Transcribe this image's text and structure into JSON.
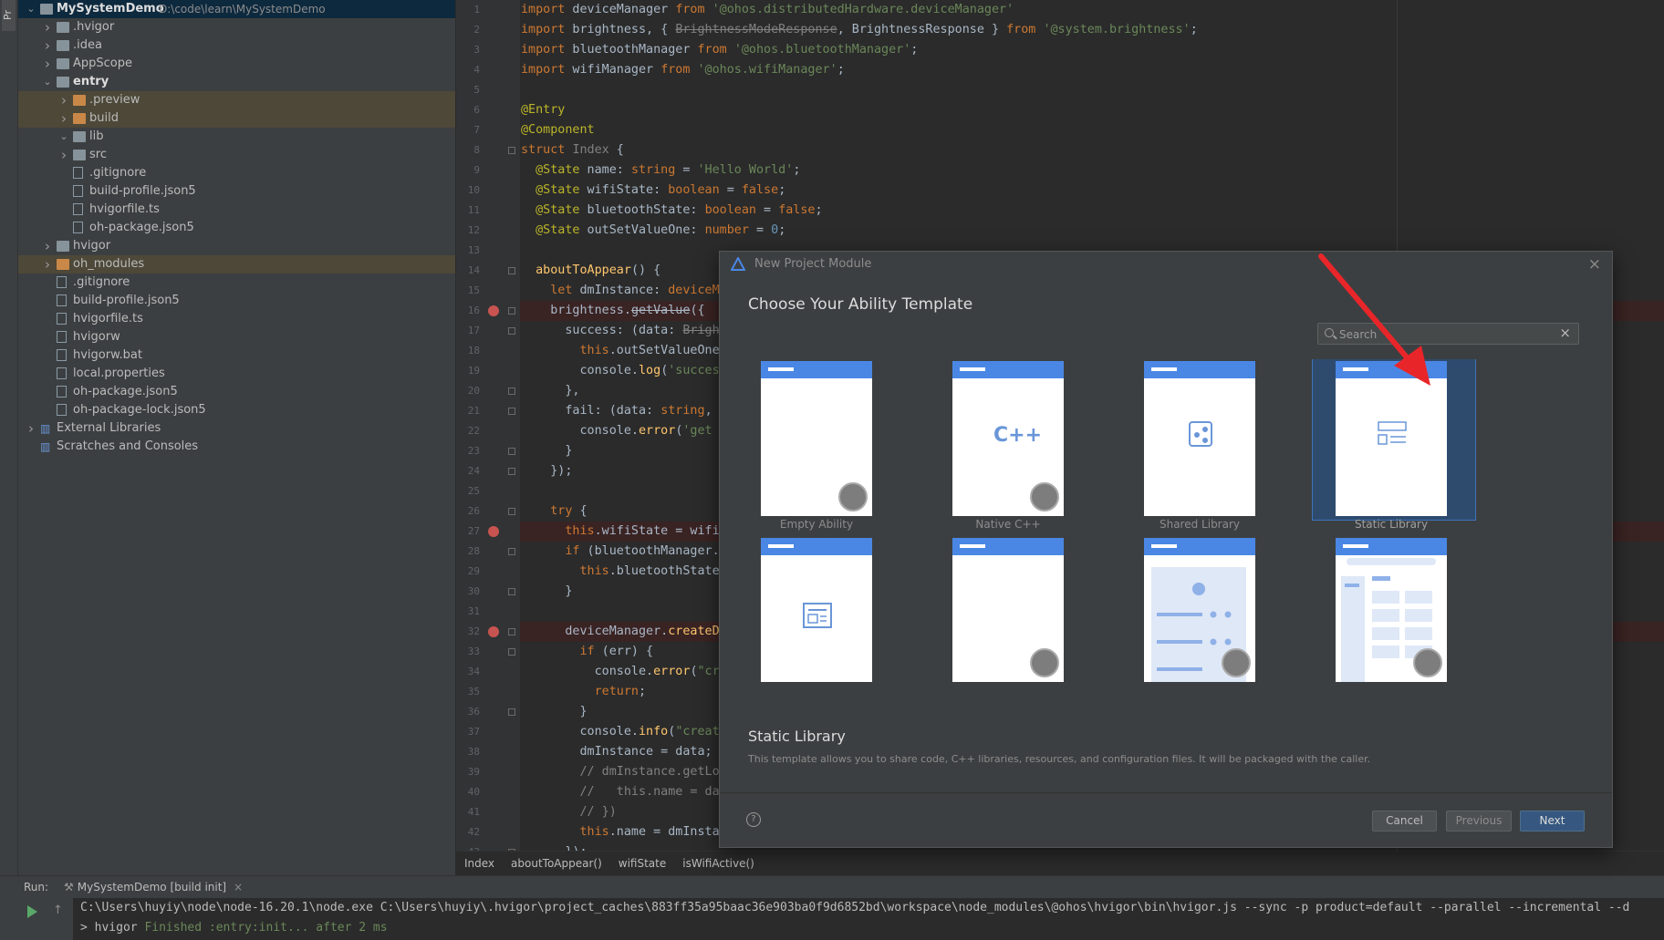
{
  "left_strip": {
    "label": "Pr"
  },
  "project_tree": [
    {
      "depth": 0,
      "chev": "v",
      "icon": "folder",
      "label": "MySystemDemo",
      "path": "D:\\code\\learn\\MySystemDemo",
      "state": "selected",
      "bold": true
    },
    {
      "depth": 1,
      "chev": ">",
      "icon": "folder",
      "label": ".hvigor"
    },
    {
      "depth": 1,
      "chev": ">",
      "icon": "folder",
      "label": ".idea"
    },
    {
      "depth": 1,
      "chev": ">",
      "icon": "folder",
      "label": "AppScope"
    },
    {
      "depth": 1,
      "chev": "v",
      "icon": "folder",
      "label": "entry",
      "bold": true
    },
    {
      "depth": 2,
      "chev": ">",
      "icon": "folder-orange",
      "label": ".preview",
      "state": "highlight"
    },
    {
      "depth": 2,
      "chev": ">",
      "icon": "folder-orange",
      "label": "build",
      "state": "highlight"
    },
    {
      "depth": 2,
      "chev": "v",
      "icon": "folder",
      "label": "lib"
    },
    {
      "depth": 2,
      "chev": ">",
      "icon": "folder",
      "label": "src"
    },
    {
      "depth": 2,
      "chev": "",
      "icon": "file",
      "label": ".gitignore"
    },
    {
      "depth": 2,
      "chev": "",
      "icon": "file",
      "label": "build-profile.json5"
    },
    {
      "depth": 2,
      "chev": "",
      "icon": "file",
      "label": "hvigorfile.ts"
    },
    {
      "depth": 2,
      "chev": "",
      "icon": "file",
      "label": "oh-package.json5"
    },
    {
      "depth": 1,
      "chev": ">",
      "icon": "folder",
      "label": "hvigor"
    },
    {
      "depth": 1,
      "chev": ">",
      "icon": "folder-orange",
      "label": "oh_modules",
      "state": "highlight"
    },
    {
      "depth": 1,
      "chev": "",
      "icon": "file",
      "label": ".gitignore"
    },
    {
      "depth": 1,
      "chev": "",
      "icon": "file",
      "label": "build-profile.json5"
    },
    {
      "depth": 1,
      "chev": "",
      "icon": "file",
      "label": "hvigorfile.ts"
    },
    {
      "depth": 1,
      "chev": "",
      "icon": "file",
      "label": "hvigorw"
    },
    {
      "depth": 1,
      "chev": "",
      "icon": "file",
      "label": "hvigorw.bat"
    },
    {
      "depth": 1,
      "chev": "",
      "icon": "file",
      "label": "local.properties"
    },
    {
      "depth": 1,
      "chev": "",
      "icon": "file",
      "label": "oh-package.json5"
    },
    {
      "depth": 1,
      "chev": "",
      "icon": "file",
      "label": "oh-package-lock.json5"
    },
    {
      "depth": 0,
      "chev": ">",
      "icon": "lib",
      "label": "External Libraries"
    },
    {
      "depth": 0,
      "chev": "",
      "icon": "lib",
      "label": "Scratches and Consoles"
    }
  ],
  "editor": {
    "lines": [
      {
        "n": "1",
        "html": "<span class=\"kw\">import</span> deviceManager <span class=\"kw\">from</span> <span class=\"str\">'@ohos.distributedHardware.deviceManager'</span>"
      },
      {
        "n": "2",
        "html": "<span class=\"kw\">import</span> brightness, { <s class=\"cmt\">BrightnessModeResponse</s>, BrightnessResponse } <span class=\"kw\">from</span> <span class=\"str\">'@system.brightness'</span>;"
      },
      {
        "n": "3",
        "html": "<span class=\"kw\">import</span> bluetoothManager <span class=\"kw\">from</span> <span class=\"str\">'@ohos.bluetoothManager'</span>;"
      },
      {
        "n": "4",
        "html": "<span class=\"kw\">import</span> wifiManager <span class=\"kw\">from</span> <span class=\"str\">'@ohos.wifiManager'</span>;"
      },
      {
        "n": "5",
        "html": ""
      },
      {
        "n": "6",
        "html": "<span class=\"anno\">@Entry</span>"
      },
      {
        "n": "7",
        "html": "<span class=\"anno\">@Component</span>"
      },
      {
        "n": "8",
        "html": "<span class=\"kw\">struct</span> <span class=\"cmt\">Index</span> {"
      },
      {
        "n": "9",
        "html": "  <span class=\"anno\">@State</span> name: <span class=\"kw\">string</span> = <span class=\"str\">'Hello World'</span>;"
      },
      {
        "n": "10",
        "html": "  <span class=\"anno\">@State</span> wifiState: <span class=\"kw\">boolean</span> = <span class=\"kw\">false</span>;"
      },
      {
        "n": "11",
        "html": "  <span class=\"anno\">@State</span> bluetoothState: <span class=\"kw\">boolean</span> = <span class=\"kw\">false</span>;"
      },
      {
        "n": "12",
        "html": "  <span class=\"anno\">@State</span> outSetValueOne: <span class=\"kw\">number</span> = <span class=\"num\">0</span>;"
      },
      {
        "n": "13",
        "html": ""
      },
      {
        "n": "14",
        "html": "  <span class=\"fn\">aboutToAppear</span>() {"
      },
      {
        "n": "15",
        "html": "    <span class=\"kw\">let</span> dmInstance: <span class=\"kw\">deviceM</span>"
      },
      {
        "n": "16",
        "html": "    brightness.<s>getValue</s>({",
        "bp": true
      },
      {
        "n": "17",
        "html": "      success: (data: <s class=\"cmt\">Brigh</s>"
      },
      {
        "n": "18",
        "html": "        <span class=\"kw\">this</span>.outSetValueOne"
      },
      {
        "n": "19",
        "html": "        console.<span class=\"fn\">log</span>(<span class=\"str\">'succes</span>"
      },
      {
        "n": "20",
        "html": "      },"
      },
      {
        "n": "21",
        "html": "      fail: (data: <span class=\"kw\">string</span>,"
      },
      {
        "n": "22",
        "html": "        console.<span class=\"fn\">error</span>(<span class=\"str\">'get</span>"
      },
      {
        "n": "23",
        "html": "      }"
      },
      {
        "n": "24",
        "html": "    });"
      },
      {
        "n": "25",
        "html": ""
      },
      {
        "n": "26",
        "html": "    <span class=\"kw\">try</span> {"
      },
      {
        "n": "27",
        "html": "      <span class=\"kw\">this</span>.wifiState = wifi",
        "bp": true
      },
      {
        "n": "28",
        "html": "      <span class=\"kw\">if</span> (bluetoothManager."
      },
      {
        "n": "29",
        "html": "        <span class=\"kw\">this</span>.bluetoothState"
      },
      {
        "n": "30",
        "html": "      }"
      },
      {
        "n": "31",
        "html": ""
      },
      {
        "n": "32",
        "html": "      deviceManager.<span class=\"fn\">createD</span>",
        "bp": true
      },
      {
        "n": "33",
        "html": "        <span class=\"kw\">if</span> (err) {"
      },
      {
        "n": "34",
        "html": "          console.<span class=\"fn\">error</span>(<span class=\"str\">\"cr</span>"
      },
      {
        "n": "35",
        "html": "          <span class=\"kw\">return</span>;"
      },
      {
        "n": "36",
        "html": "        }"
      },
      {
        "n": "37",
        "html": "        console.<span class=\"fn\">info</span>(<span class=\"str\">\"creat</span>"
      },
      {
        "n": "38",
        "html": "        dmInstance = data;"
      },
      {
        "n": "39",
        "html": "        <span class=\"cmt\">// dmInstance.getLo</span>"
      },
      {
        "n": "40",
        "html": "        <span class=\"cmt\">//   this.name = da</span>"
      },
      {
        "n": "41",
        "html": "        <span class=\"cmt\">// })</span>"
      },
      {
        "n": "42",
        "html": "        <span class=\"kw\">this</span>.name = dmInsta"
      },
      {
        "n": "43",
        "html": "      });"
      }
    ]
  },
  "breadcrumb": [
    "Index",
    "aboutToAppear()",
    "wifiState",
    "isWifiActive()"
  ],
  "run_panel": {
    "label": "Run:",
    "tab": "MySystemDemo [build init]",
    "tab_close": "×",
    "output_line1": "C:\\Users\\huyiy\\node\\node-16.20.1\\node.exe C:\\Users\\huyiy\\.hvigor\\project_caches\\883ff35a95baac36e903ba0f9d6852bd\\workspace\\node_modules\\@ohos\\hvigor\\bin\\hvigor.js --sync -p product=default --parallel --incremental --d",
    "output_line2_prefix": "> hvigor ",
    "output_line2_status": "Finished :entry:init... after 2 ms"
  },
  "modal": {
    "title": "New Project Module",
    "close": "×",
    "heading": "Choose Your Ability Template",
    "search_placeholder": "Search",
    "search_clear": "×",
    "templates": [
      {
        "name": "Empty Ability",
        "icon": "empty-ability-icon",
        "badge": true,
        "selected": false
      },
      {
        "name": "Native C++",
        "icon": "cpp-icon",
        "badge": true,
        "selected": false
      },
      {
        "name": "Shared Library",
        "icon": "shared-library-icon",
        "badge": false,
        "selected": false
      },
      {
        "name": "Static Library",
        "icon": "static-library-icon",
        "badge": false,
        "selected": true
      },
      {
        "name": "",
        "icon": "list-layout-icon",
        "badge": false,
        "selected": false
      },
      {
        "name": "",
        "icon": "profile-layout-icon",
        "badge": true,
        "selected": false
      },
      {
        "name": "",
        "icon": "grid-layout-icon",
        "badge": true,
        "selected": false
      },
      {
        "name": "",
        "icon": "table-layout-icon",
        "badge": true,
        "selected": false
      }
    ],
    "selected_title": "Static Library",
    "selected_description": "This template allows you to share code, C++ libraries, resources, and configuration files. It will be packaged with the caller.",
    "help": "?",
    "buttons": {
      "cancel": "Cancel",
      "previous": "Previous",
      "next": "Next"
    }
  },
  "colors": {
    "accent": "#4a87e5",
    "selection": "#3d74b8",
    "annotation_arrow": "#e8262a"
  }
}
